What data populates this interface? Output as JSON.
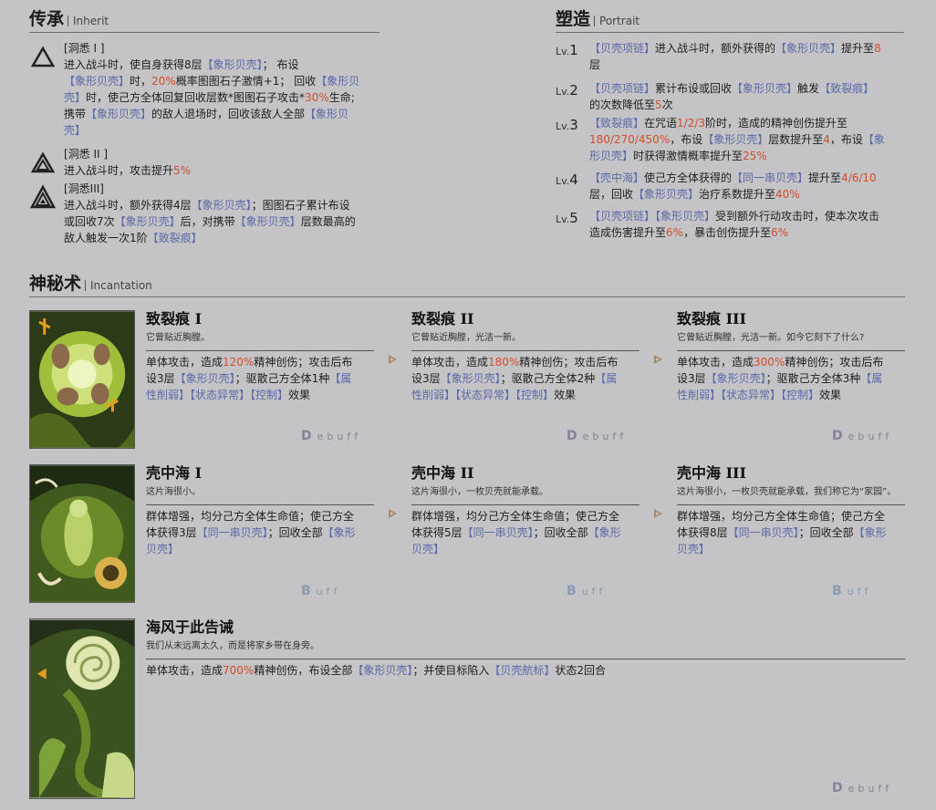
{
  "inherit": {
    "title": "传承",
    "subtitle": "Inherit",
    "items": [
      {
        "head": "[洞悉 I ]",
        "lines": [
          [
            [
              "t",
              "进入战斗时，使自身获得8层"
            ],
            [
              "h",
              "【象形贝壳】"
            ],
            [
              "t",
              "； 布设"
            ]
          ],
          [
            [
              "h",
              "【象形贝壳】"
            ],
            [
              "t",
              "时，"
            ],
            [
              "n",
              "20%"
            ],
            [
              "t",
              "概率图图石子激情+1； 回收"
            ],
            [
              "h",
              "【象形贝"
            ]
          ],
          [
            [
              "h",
              "壳】"
            ],
            [
              "t",
              "时，使己方全体回复回收层数*图图石子攻击*"
            ],
            [
              "n",
              "30%"
            ],
            [
              "t",
              "生命;"
            ]
          ],
          [
            [
              "t",
              "携带"
            ],
            [
              "h",
              "【象形贝壳】"
            ],
            [
              "t",
              "的敌人退场时，回收该敌人全部"
            ],
            [
              "h",
              "【象形贝"
            ]
          ],
          [
            [
              "h",
              "壳】"
            ]
          ]
        ]
      },
      {
        "head": "[洞悉 II ]",
        "lines": [
          [
            [
              "t",
              "进入战斗时，攻击提升"
            ],
            [
              "n",
              "5%"
            ]
          ]
        ]
      },
      {
        "head": "[洞悉III]",
        "lines": [
          [
            [
              "t",
              "进入战斗时，额外获得4层"
            ],
            [
              "h",
              "【象形贝壳】"
            ],
            [
              "t",
              "；图图石子累计布设"
            ]
          ],
          [
            [
              "t",
              "或回收7次"
            ],
            [
              "h",
              "【象形贝壳】"
            ],
            [
              "t",
              "后，对携带"
            ],
            [
              "h",
              "【象形贝壳】"
            ],
            [
              "t",
              "层数最高的"
            ]
          ],
          [
            [
              "t",
              "敌人触发一次1阶"
            ],
            [
              "h",
              "【致裂痕】"
            ]
          ]
        ]
      }
    ]
  },
  "portrait": {
    "title": "塑造",
    "subtitle": "Portrait",
    "levels": [
      {
        "lv": "Lv.",
        "n": "1",
        "lines": [
          [
            [
              "h",
              "【贝壳项链】"
            ],
            [
              "t",
              "进入战斗时，额外获得的"
            ],
            [
              "h",
              "【象形贝壳】"
            ],
            [
              "t",
              "提升至"
            ],
            [
              "n",
              "8"
            ]
          ],
          [
            [
              "t",
              "层"
            ]
          ]
        ]
      },
      {
        "lv": "Lv.",
        "n": "2",
        "lines": [
          [
            [
              "h",
              "【贝壳项链】"
            ],
            [
              "t",
              "累计布设或回收"
            ],
            [
              "h",
              "【象形贝壳】"
            ],
            [
              "t",
              "触发"
            ],
            [
              "h",
              "【致裂痕】"
            ]
          ],
          [
            [
              "t",
              "的次数降低至"
            ],
            [
              "n",
              "5"
            ],
            [
              "t",
              "次"
            ]
          ]
        ]
      },
      {
        "lv": "Lv.",
        "n": "3",
        "lines": [
          [
            [
              "h",
              "【致裂痕】"
            ],
            [
              "t",
              "在咒语"
            ],
            [
              "n",
              "1/2/3"
            ],
            [
              "t",
              "阶时，造成的精神创伤提升至"
            ]
          ],
          [
            [
              "n",
              "180/270/450%"
            ],
            [
              "t",
              "，布设"
            ],
            [
              "h",
              "【象形贝壳】"
            ],
            [
              "t",
              "层数提升至"
            ],
            [
              "n",
              "4"
            ],
            [
              "t",
              "，布设"
            ],
            [
              "h",
              "【象"
            ]
          ],
          [
            [
              "h",
              "形贝壳】"
            ],
            [
              "t",
              "时获得激情概率提升至"
            ],
            [
              "n",
              "25%"
            ]
          ]
        ]
      },
      {
        "lv": "Lv.",
        "n": "4",
        "lines": [
          [
            [
              "h",
              "【壳中海】"
            ],
            [
              "t",
              "使己方全体获得的"
            ],
            [
              "h",
              "【同一串贝壳】"
            ],
            [
              "t",
              "提升至"
            ],
            [
              "n",
              "4/6/10"
            ]
          ],
          [
            [
              "t",
              "层，回收"
            ],
            [
              "h",
              "【象形贝壳】"
            ],
            [
              "t",
              "治疗系数提升至"
            ],
            [
              "n",
              "40%"
            ]
          ]
        ]
      },
      {
        "lv": "Lv.",
        "n": "5",
        "lines": [
          [
            [
              "h",
              "【贝壳项链】"
            ],
            [
              "h",
              "【象形贝壳】"
            ],
            [
              "t",
              "受到额外行动攻击时，使本次攻击"
            ]
          ],
          [
            [
              "t",
              "造成伤害提升至"
            ],
            [
              "n",
              "6%"
            ],
            [
              "t",
              "，暴击创伤提升至"
            ],
            [
              "n",
              "6%"
            ]
          ]
        ]
      }
    ]
  },
  "incantation": {
    "title": "神秘术",
    "subtitle": "Incantation",
    "rows": [
      {
        "tag": "ebuff",
        "tag_mark": "D",
        "tag_kind": "debuff",
        "skills": [
          {
            "name": "致裂痕 I",
            "quote": "它曾贴近胸膛。",
            "lines": [
              [
                [
                  "t",
                  "单体攻击，造成"
                ],
                [
                  "n",
                  "120%"
                ],
                [
                  "t",
                  "精神创伤；攻击后布"
                ]
              ],
              [
                [
                  "t",
                  "设3层"
                ],
                [
                  "h",
                  "【象形贝壳】"
                ],
                [
                  "t",
                  "；驱散己方全体1种"
                ],
                [
                  "h",
                  "【属"
                ]
              ],
              [
                [
                  "h",
                  "性削弱】【状态异常】【控制】"
                ],
                [
                  "t",
                  "效果"
                ]
              ]
            ]
          },
          {
            "name": "致裂痕 II",
            "quote": "它曾贴近胸膛，光洁一新。",
            "lines": [
              [
                [
                  "t",
                  "单体攻击，造成"
                ],
                [
                  "n",
                  "180%"
                ],
                [
                  "t",
                  "精神创伤；攻击后布"
                ]
              ],
              [
                [
                  "t",
                  "设3层"
                ],
                [
                  "h",
                  "【象形贝壳】"
                ],
                [
                  "t",
                  "；驱散己方全体2种"
                ],
                [
                  "h",
                  "【属"
                ]
              ],
              [
                [
                  "h",
                  "性削弱】【状态异常】【控制】"
                ],
                [
                  "t",
                  "效果"
                ]
              ]
            ]
          },
          {
            "name": "致裂痕 III",
            "quote": "它曾贴近胸膛，光洁一新。如今它刻下了什么?",
            "lines": [
              [
                [
                  "t",
                  "单体攻击，造成"
                ],
                [
                  "n",
                  "300%"
                ],
                [
                  "t",
                  "精神创伤；攻击后布"
                ]
              ],
              [
                [
                  "t",
                  "设3层"
                ],
                [
                  "h",
                  "【象形贝壳】"
                ],
                [
                  "t",
                  "；驱散己方全体3种"
                ],
                [
                  "h",
                  "【属"
                ]
              ],
              [
                [
                  "h",
                  "性削弱】【状态异常】【控制】"
                ],
                [
                  "t",
                  "效果"
                ]
              ]
            ]
          }
        ]
      },
      {
        "tag": "uff",
        "tag_mark": "B",
        "tag_kind": "buff",
        "skills": [
          {
            "name": "壳中海 I",
            "quote": "这片海很小。",
            "lines": [
              [
                [
                  "t",
                  "群体增强，均分己方全体生命值；使己方全"
                ]
              ],
              [
                [
                  "t",
                  "体获得3层"
                ],
                [
                  "h",
                  "【同一串贝壳】"
                ],
                [
                  "t",
                  "；回收全部"
                ],
                [
                  "h",
                  "【象形"
                ]
              ],
              [
                [
                  "h",
                  "贝壳】"
                ]
              ]
            ]
          },
          {
            "name": "壳中海 II",
            "quote": "这片海很小，一枚贝壳就能承载。",
            "lines": [
              [
                [
                  "t",
                  "群体增强，均分己方全体生命值；使己方全"
                ]
              ],
              [
                [
                  "t",
                  "体获得5层"
                ],
                [
                  "h",
                  "【同一串贝壳】"
                ],
                [
                  "t",
                  "；回收全部"
                ],
                [
                  "h",
                  "【象形"
                ]
              ],
              [
                [
                  "h",
                  "贝壳】"
                ]
              ]
            ]
          },
          {
            "name": "壳中海 III",
            "quote": "这片海很小，一枚贝壳就能承载，我们称它为“家园”。",
            "lines": [
              [
                [
                  "t",
                  "群体增强，均分己方全体生命值；使己方全"
                ]
              ],
              [
                [
                  "t",
                  "体获得8层"
                ],
                [
                  "h",
                  "【同一串贝壳】"
                ],
                [
                  "t",
                  "；回收全部"
                ],
                [
                  "h",
                  "【象形"
                ]
              ],
              [
                [
                  "h",
                  "贝壳】"
                ]
              ]
            ]
          }
        ]
      },
      {
        "tag": "ebuff",
        "tag_mark": "D",
        "tag_kind": "debuff",
        "skills": [
          {
            "name": "海风于此告诫",
            "quote": "我们从未远离太久，而是将家乡带在身旁。",
            "lines": [
              [
                [
                  "t",
                  "单体攻击，造成"
                ],
                [
                  "n",
                  "700%"
                ],
                [
                  "t",
                  "精神创伤，布设全部"
                ],
                [
                  "h",
                  "【象形贝壳】"
                ],
                [
                  "t",
                  "；并使目标陷入"
                ],
                [
                  "h",
                  "【贝壳航标】"
                ],
                [
                  "t",
                  "状态2回合"
                ]
              ]
            ]
          }
        ]
      }
    ]
  },
  "colors": {
    "highlight": "#5b6aa8",
    "number": "#d24e2c",
    "background": "#c4c3c6"
  }
}
